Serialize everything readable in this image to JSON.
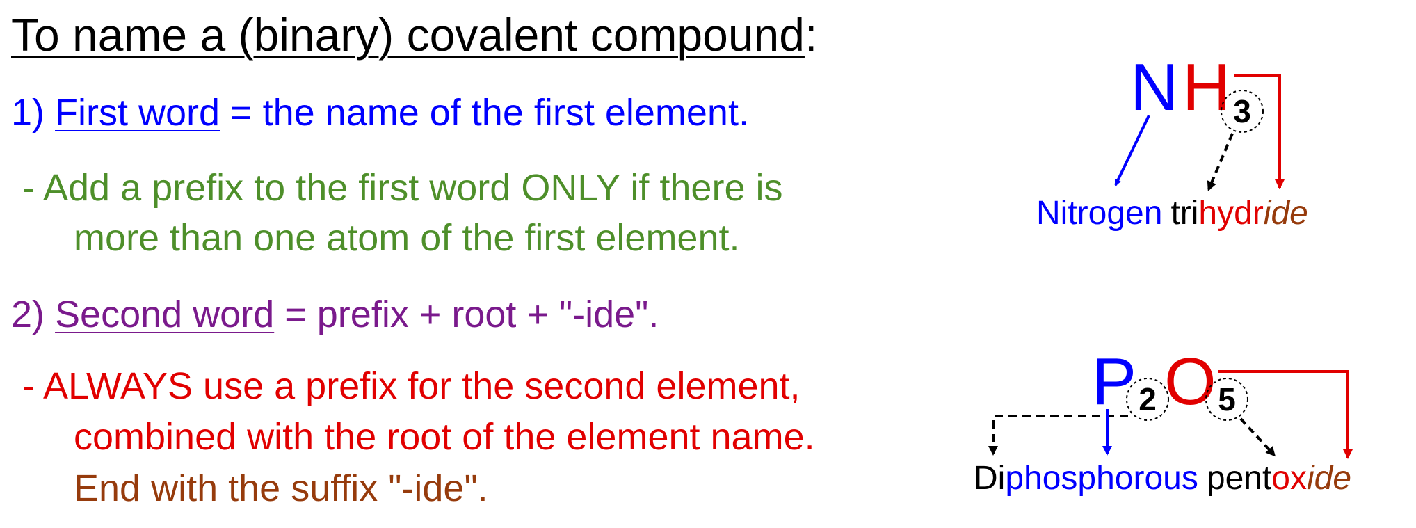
{
  "title": {
    "main": "To name a (binary) covalent compound",
    "colon": ":"
  },
  "rule1": {
    "num": "1) ",
    "term": "First word",
    "rest": " = the name of the first element.",
    "note_line1": "- Add a prefix to the first word ONLY if there is",
    "note_line2": "more than one atom of the first element."
  },
  "rule2": {
    "num": "2) ",
    "term": "Second word",
    "rest": " = prefix + root + \"-ide\".",
    "note_line1": "- ALWAYS use a prefix for the second element,",
    "note_line2": "combined with the root of the element name.",
    "note_line3": "End with the suffix \"-ide\"."
  },
  "example1": {
    "symbol1": "N",
    "symbol2": "H",
    "subscript": "3",
    "name_first": "Nitrogen",
    "name_prefix": "tri",
    "name_root": "hydr",
    "name_suffix": "ide"
  },
  "example2": {
    "symbol1": "P",
    "subscript1": "2",
    "symbol2": "O",
    "subscript2": "5",
    "name_prefix1": "Di",
    "name_first": "phosphorous",
    "name_prefix2": "pent",
    "name_root": "ox",
    "name_suffix": "ide"
  },
  "colors": {
    "blue": "#0000ff",
    "green": "#4e8f2a",
    "purple": "#7a1a8c",
    "red": "#e10000",
    "brown": "#963b0c"
  }
}
